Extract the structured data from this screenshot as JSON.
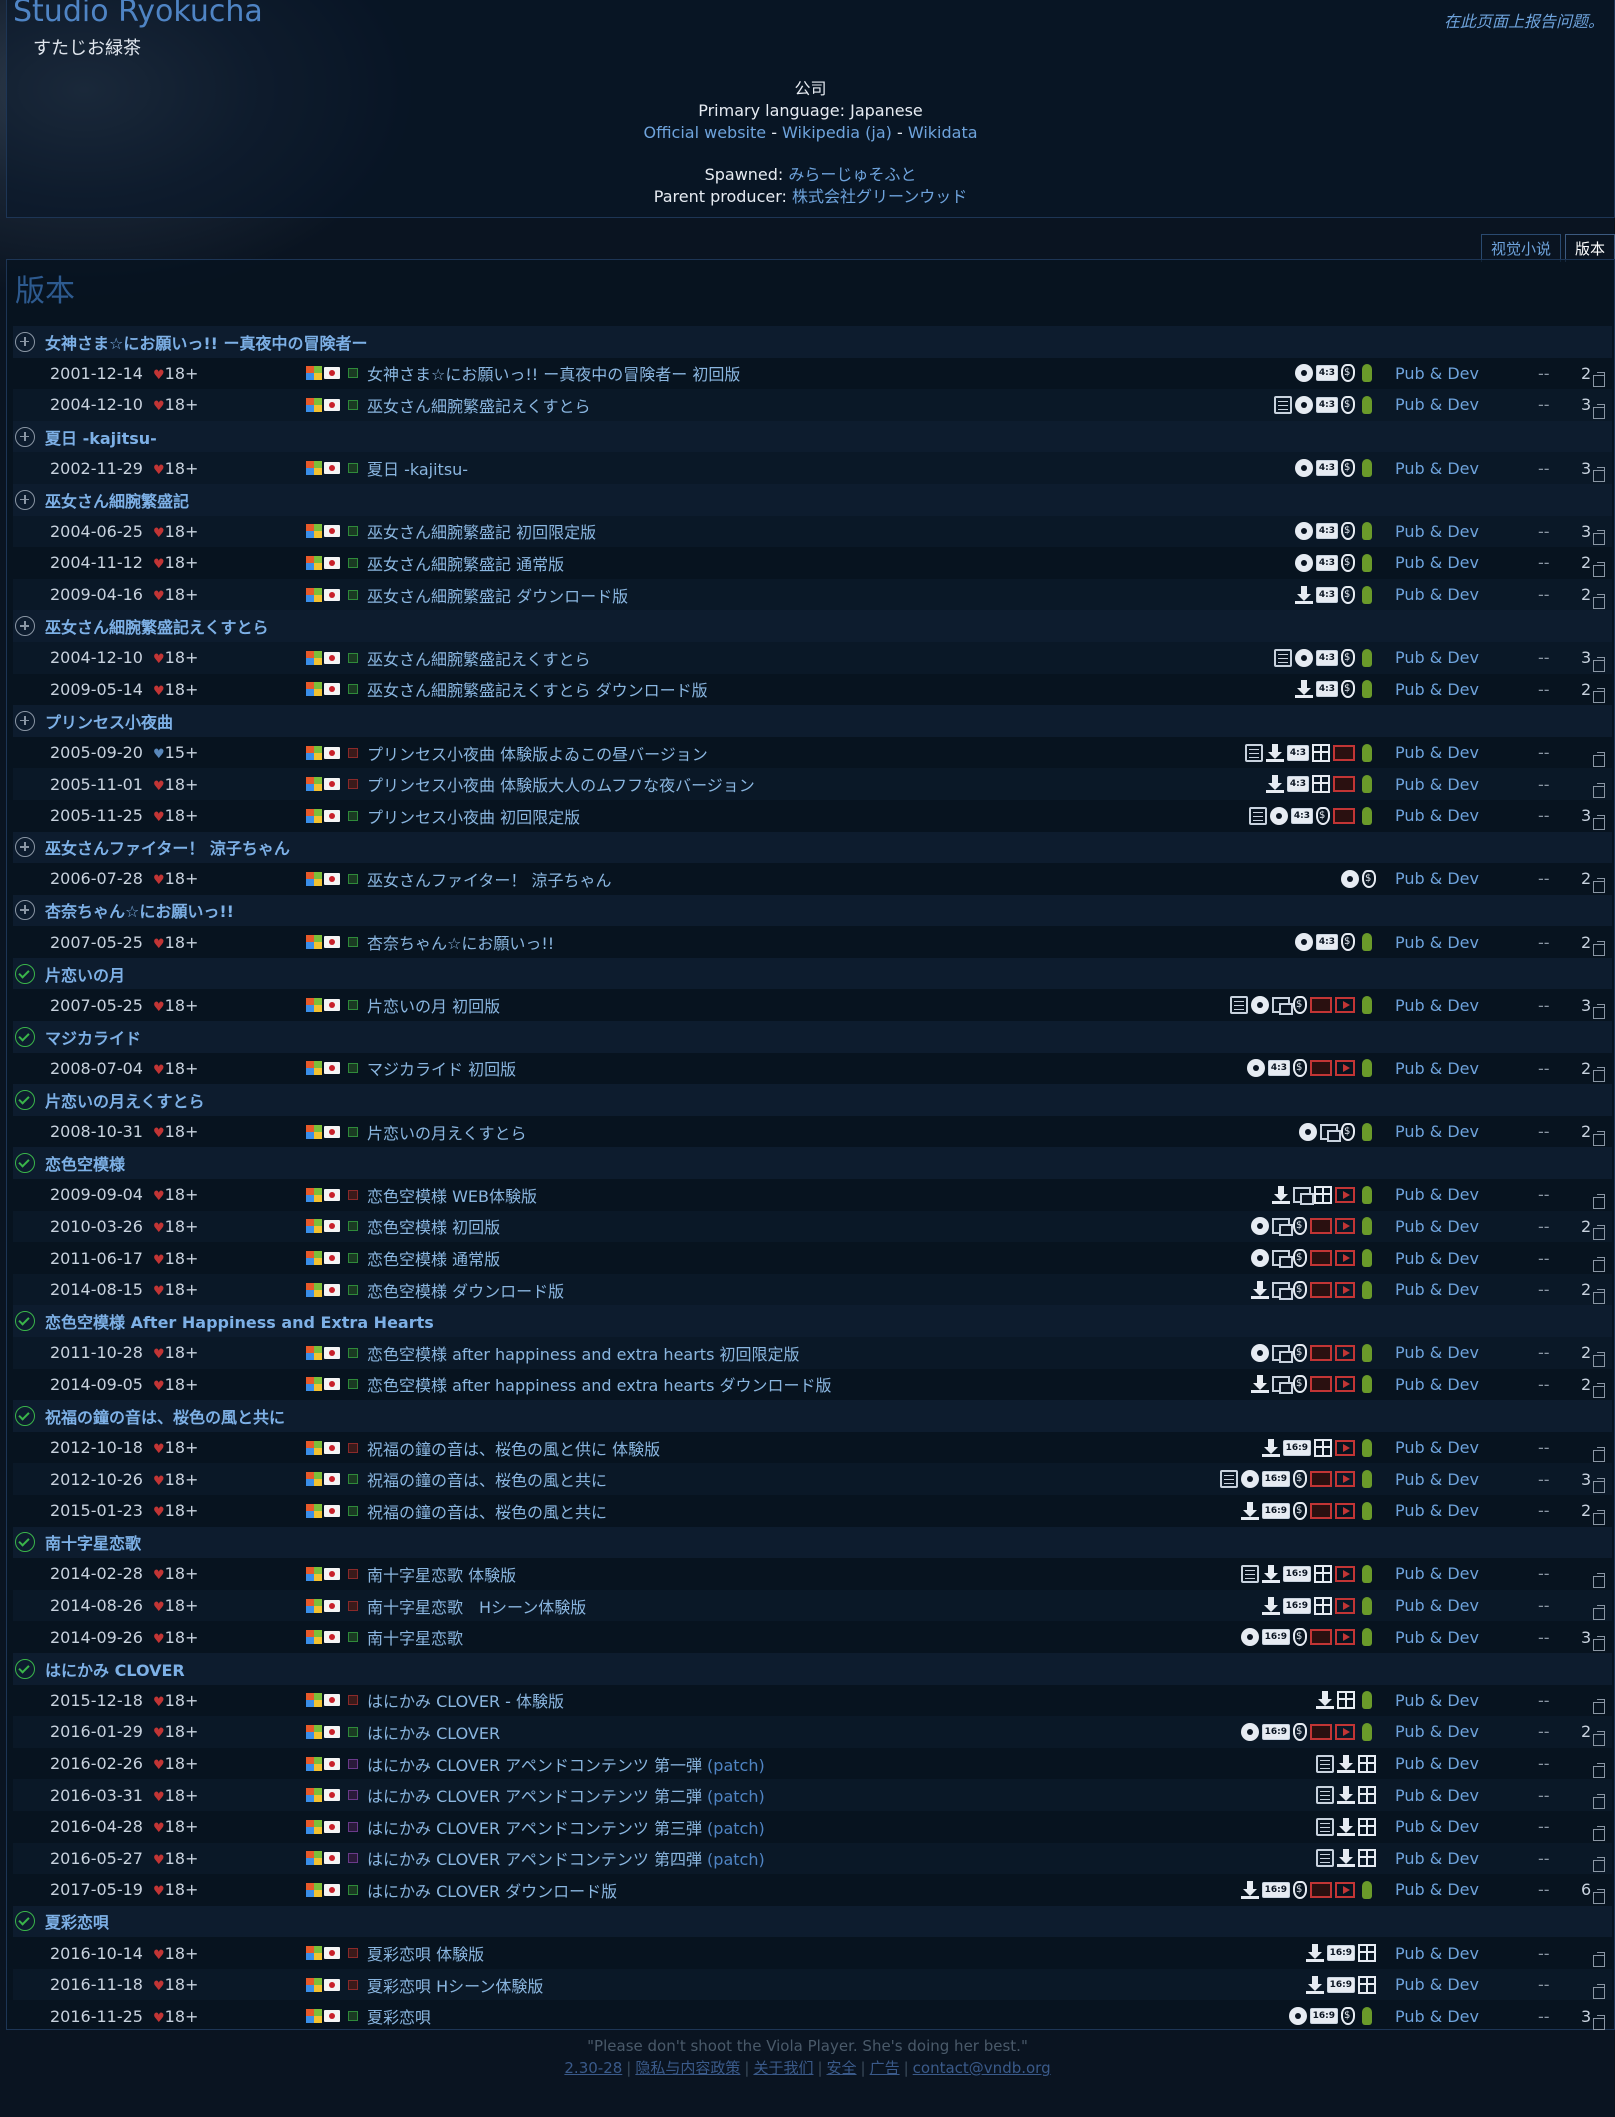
{
  "header": {
    "brand": "Studio Ryokucha",
    "brand_original": "すたじお緑茶",
    "report": "在此页面上报告问题。",
    "type": "公司",
    "language_label": "Primary language:",
    "language": "Japanese",
    "links": [
      "Official website",
      "Wikipedia (ja)",
      "Wikidata"
    ],
    "spawned_label": "Spawned:",
    "spawned": "みらーじゅそふと",
    "parent_label": "Parent producer:",
    "parent": "株式会社グリーンウッド"
  },
  "tabs": [
    "视觉小说",
    "版本"
  ],
  "section_title": "版本",
  "footer": {
    "quote": "\"Please don't shoot the Viola Player. She's doing her best.\"",
    "links": [
      "2.30-28",
      "隐私与内容政策",
      "关于我们",
      "安全",
      "广告",
      "contact@vndb.org"
    ]
  },
  "pub_label": "Pub & Dev",
  "dash": "--",
  "releases": [
    {
      "status": "plus",
      "title": "女神さま☆にお願いっ!! ー真夜中の冒険者ー",
      "rows": [
        {
          "date": "2001-12-14",
          "age": "18+",
          "ver": "full",
          "title": "女神さま☆にお願いっ!! ー真夜中の冒険者ー 初回版",
          "icons": [
            "cd",
            "res:4:3",
            "bag",
            "mic"
          ],
          "num": "2"
        },
        {
          "date": "2004-12-10",
          "age": "18+",
          "ver": "full",
          "title": "巫女さん細腕繁盛記えくすとら",
          "icons": [
            "note",
            "cd",
            "res:4:3",
            "bag",
            "mic"
          ],
          "num": "3"
        }
      ]
    },
    {
      "status": "plus",
      "title": "夏日 -kajitsu-",
      "rows": [
        {
          "date": "2002-11-29",
          "age": "18+",
          "ver": "full",
          "title": "夏日 -kajitsu-",
          "icons": [
            "cd",
            "res:4:3",
            "bag",
            "mic"
          ],
          "num": "3"
        }
      ]
    },
    {
      "status": "plus",
      "title": "巫女さん細腕繁盛記",
      "rows": [
        {
          "date": "2004-06-25",
          "age": "18+",
          "ver": "full",
          "title": "巫女さん細腕繁盛記 初回限定版",
          "icons": [
            "cd",
            "res:4:3",
            "bag",
            "mic"
          ],
          "num": "3"
        },
        {
          "date": "2004-11-12",
          "age": "18+",
          "ver": "full",
          "title": "巫女さん細腕繁盛記 通常版",
          "icons": [
            "cd",
            "res:4:3",
            "bag",
            "mic"
          ],
          "num": "2"
        },
        {
          "date": "2009-04-16",
          "age": "18+",
          "ver": "full",
          "title": "巫女さん細腕繁盛記 ダウンロード版",
          "icons": [
            "dl",
            "res:4:3",
            "bag",
            "mic"
          ],
          "num": "2"
        }
      ]
    },
    {
      "status": "plus",
      "title": "巫女さん細腕繁盛記えくすとら",
      "rows": [
        {
          "date": "2004-12-10",
          "age": "18+",
          "ver": "full",
          "title": "巫女さん細腕繁盛記えくすとら",
          "icons": [
            "note",
            "cd",
            "res:4:3",
            "bag",
            "mic"
          ],
          "num": "3"
        },
        {
          "date": "2009-05-14",
          "age": "18+",
          "ver": "full",
          "title": "巫女さん細腕繁盛記えくすとら ダウンロード版",
          "icons": [
            "dl",
            "res:4:3",
            "bag",
            "mic"
          ],
          "num": "2"
        }
      ]
    },
    {
      "status": "plus",
      "title": "プリンセス小夜曲",
      "rows": [
        {
          "date": "2005-09-20",
          "age": "15+",
          "ver": "trial",
          "title": "プリンセス小夜曲 体験版よゐこの昼バージョン",
          "icons": [
            "note",
            "dl",
            "res:4:3",
            "gift",
            "ero",
            "mic"
          ],
          "num": ""
        },
        {
          "date": "2005-11-01",
          "age": "18+",
          "ver": "trial",
          "title": "プリンセス小夜曲 体験版大人のムフフな夜バージョン",
          "icons": [
            "dl",
            "res:4:3",
            "gift",
            "ero",
            "mic"
          ],
          "num": ""
        },
        {
          "date": "2005-11-25",
          "age": "18+",
          "ver": "full",
          "title": "プリンセス小夜曲 初回限定版",
          "icons": [
            "note",
            "cd",
            "res:4:3",
            "bag",
            "ero",
            "mic"
          ],
          "num": "3"
        }
      ]
    },
    {
      "status": "plus",
      "title": "巫女さんファイター！ 涼子ちゃん",
      "rows": [
        {
          "date": "2006-07-28",
          "age": "18+",
          "ver": "full",
          "title": "巫女さんファイター！ 涼子ちゃん",
          "icons": [
            "cd",
            "bag"
          ],
          "num": "2"
        }
      ]
    },
    {
      "status": "plus",
      "title": "杏奈ちゃん☆にお願いっ!!",
      "rows": [
        {
          "date": "2007-05-25",
          "age": "18+",
          "ver": "full",
          "title": "杏奈ちゃん☆にお願いっ!!",
          "icons": [
            "cd",
            "res:4:3",
            "bag",
            "mic"
          ],
          "num": "2"
        }
      ]
    },
    {
      "status": "check",
      "title": "片恋いの月",
      "rows": [
        {
          "date": "2007-05-25",
          "age": "18+",
          "ver": "full",
          "title": "片恋いの月 初回版",
          "icons": [
            "note",
            "cd",
            "box",
            "bag",
            "ero",
            "anim",
            "mic"
          ],
          "num": "3"
        }
      ]
    },
    {
      "status": "check",
      "title": "マジカライド",
      "rows": [
        {
          "date": "2008-07-04",
          "age": "18+",
          "ver": "full",
          "title": "マジカライド 初回版",
          "icons": [
            "cd",
            "res:4:3",
            "bag",
            "ero",
            "anim",
            "mic"
          ],
          "num": "2"
        }
      ]
    },
    {
      "status": "check",
      "title": "片恋いの月えくすとら",
      "rows": [
        {
          "date": "2008-10-31",
          "age": "18+",
          "ver": "full",
          "title": "片恋いの月えくすとら",
          "icons": [
            "cd",
            "box",
            "bag",
            "mic"
          ],
          "num": "2"
        }
      ]
    },
    {
      "status": "check",
      "title": "恋色空模様",
      "rows": [
        {
          "date": "2009-09-04",
          "age": "18+",
          "ver": "trial",
          "title": "恋色空模様 WEB体験版",
          "icons": [
            "dl",
            "box",
            "gift",
            "anim",
            "mic"
          ],
          "num": ""
        },
        {
          "date": "2010-03-26",
          "age": "18+",
          "ver": "full",
          "title": "恋色空模様 初回版",
          "icons": [
            "cd",
            "box",
            "bag",
            "ero",
            "anim",
            "mic"
          ],
          "num": "2"
        },
        {
          "date": "2011-06-17",
          "age": "18+",
          "ver": "full",
          "title": "恋色空模様 通常版",
          "icons": [
            "cd",
            "box",
            "bag",
            "ero",
            "anim",
            "mic"
          ],
          "num": ""
        },
        {
          "date": "2014-08-15",
          "age": "18+",
          "ver": "full",
          "title": "恋色空模様 ダウンロード版",
          "icons": [
            "dl",
            "box",
            "bag",
            "ero",
            "anim",
            "mic"
          ],
          "num": "2"
        }
      ]
    },
    {
      "status": "check",
      "title": "恋色空模様 After Happiness and Extra Hearts",
      "rows": [
        {
          "date": "2011-10-28",
          "age": "18+",
          "ver": "full",
          "title": "恋色空模様 after happiness and extra hearts 初回限定版",
          "icons": [
            "cd",
            "box",
            "bag",
            "ero",
            "anim",
            "mic"
          ],
          "num": "2"
        },
        {
          "date": "2014-09-05",
          "age": "18+",
          "ver": "full",
          "title": "恋色空模様 after happiness and extra hearts ダウンロード版",
          "icons": [
            "dl",
            "box",
            "bag",
            "ero",
            "anim",
            "mic"
          ],
          "num": "2"
        }
      ]
    },
    {
      "status": "check",
      "title": "祝福の鐘の音は、桜色の風と共に",
      "rows": [
        {
          "date": "2012-10-18",
          "age": "18+",
          "ver": "trial",
          "title": "祝福の鐘の音は、桜色の風と供に 体験版",
          "icons": [
            "dl",
            "res:16:9",
            "gift",
            "anim",
            "mic"
          ],
          "num": ""
        },
        {
          "date": "2012-10-26",
          "age": "18+",
          "ver": "full",
          "title": "祝福の鐘の音は、桜色の風と共に",
          "icons": [
            "note",
            "cd",
            "res:16:9",
            "bag",
            "ero",
            "anim",
            "mic"
          ],
          "num": "3"
        },
        {
          "date": "2015-01-23",
          "age": "18+",
          "ver": "full",
          "title": "祝福の鐘の音は、桜色の風と共に",
          "icons": [
            "dl",
            "res:16:9",
            "bag",
            "ero",
            "anim",
            "mic"
          ],
          "num": "2"
        }
      ]
    },
    {
      "status": "check",
      "title": "南十字星恋歌",
      "rows": [
        {
          "date": "2014-02-28",
          "age": "18+",
          "ver": "trial",
          "title": "南十字星恋歌 体験版",
          "icons": [
            "note",
            "dl",
            "res:16:9",
            "gift",
            "anim",
            "mic"
          ],
          "num": ""
        },
        {
          "date": "2014-08-26",
          "age": "18+",
          "ver": "trial",
          "title": "南十字星恋歌　Hシーン体験版",
          "icons": [
            "dl",
            "res:16:9",
            "gift",
            "anim",
            "mic"
          ],
          "num": ""
        },
        {
          "date": "2014-09-26",
          "age": "18+",
          "ver": "full",
          "title": "南十字星恋歌",
          "icons": [
            "cd",
            "res:16:9",
            "bag",
            "ero",
            "anim",
            "mic"
          ],
          "num": "3"
        }
      ]
    },
    {
      "status": "check",
      "title": "はにかみ CLOVER",
      "rows": [
        {
          "date": "2015-12-18",
          "age": "18+",
          "ver": "trial",
          "title": "はにかみ CLOVER - 体験版",
          "icons": [
            "dl",
            "gift",
            "mic"
          ],
          "num": ""
        },
        {
          "date": "2016-01-29",
          "age": "18+",
          "ver": "full",
          "title": "はにかみ CLOVER",
          "icons": [
            "cd",
            "res:16:9",
            "bag",
            "ero",
            "anim",
            "mic"
          ],
          "num": "2"
        },
        {
          "date": "2016-02-26",
          "age": "18+",
          "ver": "patch",
          "title": "はにかみ CLOVER アペンドコンテンツ 第一弾",
          "patch": "(patch)",
          "icons": [
            "note",
            "dl",
            "gift"
          ],
          "num": ""
        },
        {
          "date": "2016-03-31",
          "age": "18+",
          "ver": "patch",
          "title": "はにかみ CLOVER アペンドコンテンツ 第二弾",
          "patch": "(patch)",
          "icons": [
            "note",
            "dl",
            "gift"
          ],
          "num": ""
        },
        {
          "date": "2016-04-28",
          "age": "18+",
          "ver": "patch",
          "title": "はにかみ CLOVER アペンドコンテンツ 第三弾",
          "patch": "(patch)",
          "icons": [
            "note",
            "dl",
            "gift"
          ],
          "num": ""
        },
        {
          "date": "2016-05-27",
          "age": "18+",
          "ver": "patch",
          "title": "はにかみ CLOVER アペンドコンテンツ 第四弾",
          "patch": "(patch)",
          "icons": [
            "note",
            "dl",
            "gift"
          ],
          "num": ""
        },
        {
          "date": "2017-05-19",
          "age": "18+",
          "ver": "full",
          "title": "はにかみ CLOVER ダウンロード版",
          "icons": [
            "dl",
            "res:16:9",
            "bag",
            "ero",
            "anim",
            "mic"
          ],
          "num": "6"
        }
      ]
    },
    {
      "status": "check",
      "title": "夏彩恋唄",
      "rows": [
        {
          "date": "2016-10-14",
          "age": "18+",
          "ver": "trial",
          "title": "夏彩恋唄 体験版",
          "icons": [
            "dl",
            "res:16:9",
            "gift"
          ],
          "num": ""
        },
        {
          "date": "2016-11-18",
          "age": "18+",
          "ver": "trial",
          "title": "夏彩恋唄 Hシーン体験版",
          "icons": [
            "dl",
            "res:16:9",
            "gift"
          ],
          "num": ""
        },
        {
          "date": "2016-11-25",
          "age": "18+",
          "ver": "full",
          "title": "夏彩恋唄",
          "icons": [
            "cd",
            "res:16:9",
            "bag",
            "mic"
          ],
          "num": "3"
        }
      ]
    }
  ]
}
